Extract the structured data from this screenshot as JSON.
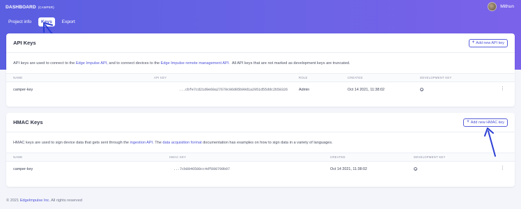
{
  "header": {
    "title": "DASHBOARD",
    "project": "(CAMPER)",
    "username": "Mithun"
  },
  "tabs": [
    {
      "label": "Project info"
    },
    {
      "label": "Keys",
      "active": true
    },
    {
      "label": "Export"
    }
  ],
  "api_keys": {
    "title": "API Keys",
    "add_button": "Add new API key",
    "desc_before": "API keys are used to connect to the",
    "desc_link1": "Edge Impulse API,",
    "desc_middle": "and to connect devices to the",
    "desc_link2": "Edge Impulse remote management API.",
    "desc_after": "All API keys that are not marked as development keys are truncated.",
    "columns": [
      "NAME",
      "API KEY",
      "ROLE",
      "CREATED",
      "DEVELOPMENT KEY"
    ],
    "rows": [
      {
        "name": "camper-key",
        "key": "...cbfe7cd21d9e60a27679c06d05b99d1a2951d55ddc2b58326",
        "role": "Admin",
        "created": "Oct 14 2021, 11:38:02",
        "development_key": true
      }
    ]
  },
  "hmac_keys": {
    "title": "HMAC Keys",
    "add_button": "Add new HMAC key",
    "desc_before": "HMAC keys are used to sign device data that gets sent through the",
    "desc_link1": "ingestion API.",
    "desc_middle": "The",
    "desc_link2": "data acquisition format",
    "desc_after": "documentation has examples on how to sign data in a variety of languages.",
    "columns": [
      "NAME",
      "HMAC KEY",
      "CREATED",
      "DEVELOPMENT KEY"
    ],
    "rows": [
      {
        "name": "camper-key",
        "key": "...7cb8946500cc4df890799b97",
        "created": "Oct 14 2021, 11:38:02",
        "development_key": true
      }
    ]
  },
  "footer": {
    "year": "© 2021",
    "company": "EdgeImpulse Inc.",
    "rights": "All rights reserved"
  },
  "colors": {
    "accent": "#4c52d6",
    "annotation_arrow": "#2b3ed6"
  }
}
